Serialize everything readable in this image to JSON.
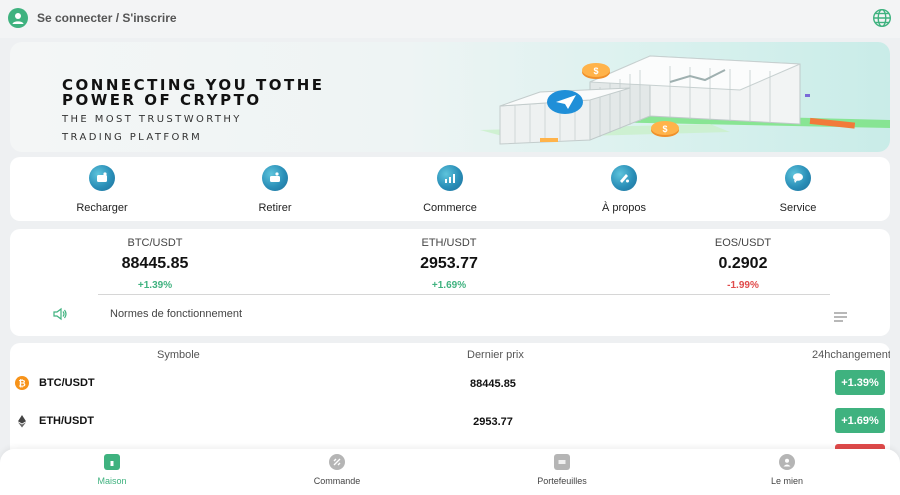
{
  "header": {
    "login_label": "Se connecter / S'inscrire"
  },
  "banner": {
    "title_line1": "CONNECTING YOU TOTHE",
    "title_line2": "POWER OF CRYPTO",
    "subtitle_line1": "THE MOST TRUSTWORTHY",
    "subtitle_line2": "TRADING PLATFORM",
    "coin_symbol": "$"
  },
  "actions": [
    {
      "label": "Recharger",
      "icon": "wallet-in-icon"
    },
    {
      "label": "Retirer",
      "icon": "wallet-out-icon"
    },
    {
      "label": "Commerce",
      "icon": "chart-icon"
    },
    {
      "label": "À propos",
      "icon": "info-icon"
    },
    {
      "label": "Service",
      "icon": "chat-icon"
    }
  ],
  "tickers": [
    {
      "pair": "BTC/USDT",
      "price": "88445.85",
      "change": "+1.39%",
      "direction": "up"
    },
    {
      "pair": "ETH/USDT",
      "price": "2953.77",
      "change": "+1.69%",
      "direction": "up"
    },
    {
      "pair": "EOS/USDT",
      "price": "0.2902",
      "change": "-1.99%",
      "direction": "down"
    }
  ],
  "notice": {
    "text": "Normes de fonctionnement"
  },
  "market": {
    "headers": {
      "symbol": "Symbole",
      "last_price": "Dernier prix",
      "change": "24hchangement"
    },
    "rows": [
      {
        "symbol": "BTC/USDT",
        "price": "88445.85",
        "change": "+1.39%",
        "direction": "up",
        "icon": "bitcoin-icon"
      },
      {
        "symbol": "ETH/USDT",
        "price": "2953.77",
        "change": "+1.69%",
        "direction": "up",
        "icon": "ethereum-icon"
      }
    ]
  },
  "nav": [
    {
      "label": "Maison",
      "active": true
    },
    {
      "label": "Commande",
      "active": false
    },
    {
      "label": "Portefeuilles",
      "active": false
    },
    {
      "label": "Le mien",
      "active": false
    }
  ],
  "colors": {
    "accent": "#3fb27f",
    "negative": "#e04a4a",
    "icon_blue": "#2a8fb8"
  }
}
